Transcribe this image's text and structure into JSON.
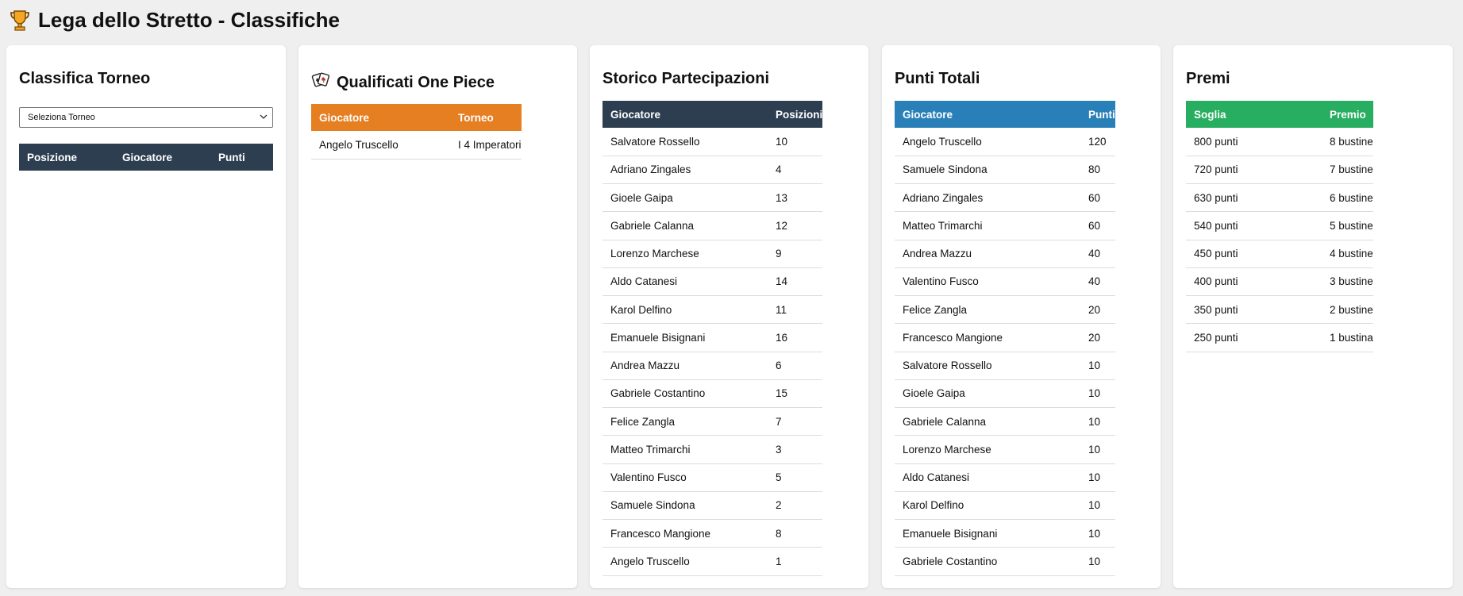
{
  "header": {
    "title": "Lega dello Stretto - Classifiche",
    "icon": "trophy-icon"
  },
  "classifica": {
    "title": "Classifica Torneo",
    "select_value": "Seleziona Torneo",
    "columns": [
      "Posizione",
      "Giocatore",
      "Punti"
    ]
  },
  "qualificati": {
    "title": "Qualificati One Piece",
    "icon": "playing-cards-icon",
    "columns": [
      "Giocatore",
      "Torneo"
    ],
    "rows": [
      [
        "Angelo Truscello",
        "I 4 Imperatori"
      ]
    ]
  },
  "storico": {
    "title": "Storico Partecipazioni",
    "columns": [
      "Giocatore",
      "Posizioni"
    ],
    "rows": [
      [
        "Salvatore Rossello",
        "10"
      ],
      [
        "Adriano Zingales",
        "4"
      ],
      [
        "Gioele Gaipa",
        "13"
      ],
      [
        "Gabriele Calanna",
        "12"
      ],
      [
        "Lorenzo Marchese",
        "9"
      ],
      [
        "Aldo Catanesi",
        "14"
      ],
      [
        "Karol Delfino",
        "11"
      ],
      [
        "Emanuele Bisignani",
        "16"
      ],
      [
        "Andrea Mazzu",
        "6"
      ],
      [
        "Gabriele Costantino",
        "15"
      ],
      [
        "Felice Zangla",
        "7"
      ],
      [
        "Matteo Trimarchi",
        "3"
      ],
      [
        "Valentino Fusco",
        "5"
      ],
      [
        "Samuele Sindona",
        "2"
      ],
      [
        "Francesco Mangione",
        "8"
      ],
      [
        "Angelo Truscello",
        "1"
      ]
    ]
  },
  "punti": {
    "title": "Punti Totali",
    "columns": [
      "Giocatore",
      "Punti"
    ],
    "rows": [
      [
        "Angelo Truscello",
        "120"
      ],
      [
        "Samuele Sindona",
        "80"
      ],
      [
        "Adriano Zingales",
        "60"
      ],
      [
        "Matteo Trimarchi",
        "60"
      ],
      [
        "Andrea Mazzu",
        "40"
      ],
      [
        "Valentino Fusco",
        "40"
      ],
      [
        "Felice Zangla",
        "20"
      ],
      [
        "Francesco Mangione",
        "20"
      ],
      [
        "Salvatore Rossello",
        "10"
      ],
      [
        "Gioele Gaipa",
        "10"
      ],
      [
        "Gabriele Calanna",
        "10"
      ],
      [
        "Lorenzo Marchese",
        "10"
      ],
      [
        "Aldo Catanesi",
        "10"
      ],
      [
        "Karol Delfino",
        "10"
      ],
      [
        "Emanuele Bisignani",
        "10"
      ],
      [
        "Gabriele Costantino",
        "10"
      ]
    ]
  },
  "premi": {
    "title": "Premi",
    "columns": [
      "Soglia",
      "Premio"
    ],
    "rows": [
      [
        "800 punti",
        "8 bustine"
      ],
      [
        "720 punti",
        "7 bustine"
      ],
      [
        "630 punti",
        "6 bustine"
      ],
      [
        "540 punti",
        "5 bustine"
      ],
      [
        "450 punti",
        "4 bustine"
      ],
      [
        "400 punti",
        "3 bustine"
      ],
      [
        "350 punti",
        "2 bustine"
      ],
      [
        "250 punti",
        "1 bustina"
      ]
    ]
  },
  "colors": {
    "dark_header": "#2c3e50",
    "orange_header": "#e67e22",
    "blue_header": "#2980b9",
    "green_header": "#27ae60"
  }
}
